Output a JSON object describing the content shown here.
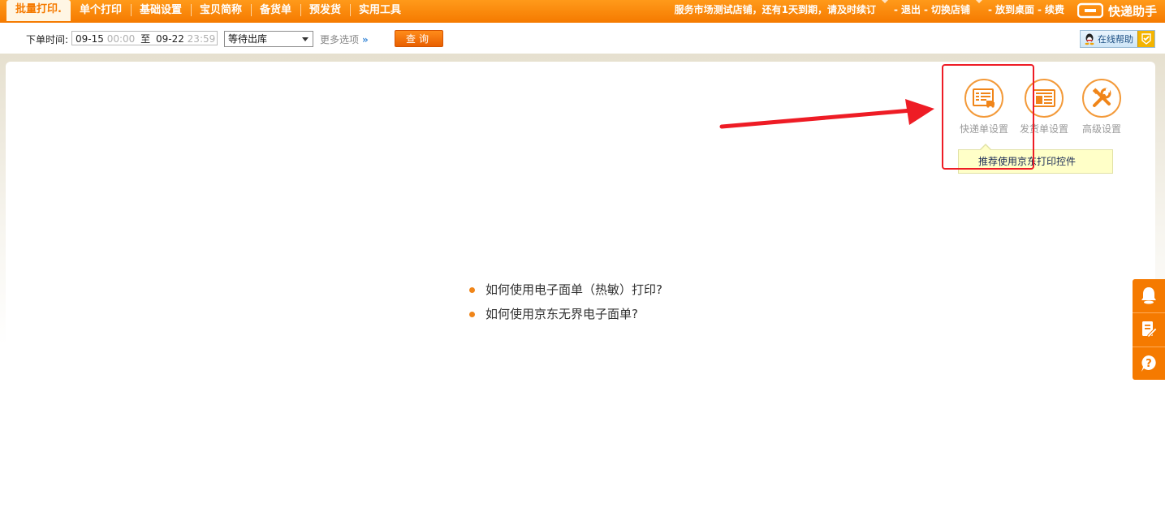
{
  "nav": {
    "tabs": [
      {
        "label": "批量打印.",
        "active": true
      },
      {
        "label": "单个打印"
      },
      {
        "label": "基础设置"
      },
      {
        "label": "宝贝简称"
      },
      {
        "label": "备货单"
      },
      {
        "label": "预发货"
      },
      {
        "label": "实用工具"
      }
    ]
  },
  "account": {
    "shop_notice": "服务市场测试店铺，还有1天到期，请及时续订",
    "sep": "-",
    "logout": "退出",
    "switch_shop": "切换店铺",
    "to_desktop": "放到桌面",
    "renew": "续费"
  },
  "brand": {
    "name": "快递助手"
  },
  "filter": {
    "order_time_label": "下单时间:",
    "date_from": "09-15",
    "time_from": "00:00",
    "to_label": "至",
    "date_to": "09-22",
    "time_to": "23:59",
    "status_selected": "等待出库",
    "more_options": "更多选项",
    "more_chevron": "»",
    "query_button": "查询"
  },
  "help_button": {
    "label": "在线帮助"
  },
  "settings_tools": [
    {
      "label": "快递单设置"
    },
    {
      "label": "发货单设置"
    },
    {
      "label": "高级设置"
    }
  ],
  "tooltip": {
    "text": "推荐使用京东打印控件"
  },
  "help_links": [
    {
      "label": "如何使用电子面单（热敏）打印?"
    },
    {
      "label": "如何使用京东无界电子面单?"
    }
  ],
  "colors": {
    "brand_orange": "#f57a00",
    "annotation_red": "#ee1c25",
    "tooltip_bg": "#ffffc8"
  },
  "icons": [
    "express-waybill-icon",
    "shipping-slip-icon",
    "tools-icon",
    "qq-icon",
    "bell-icon",
    "edit-note-icon",
    "question-icon"
  ]
}
